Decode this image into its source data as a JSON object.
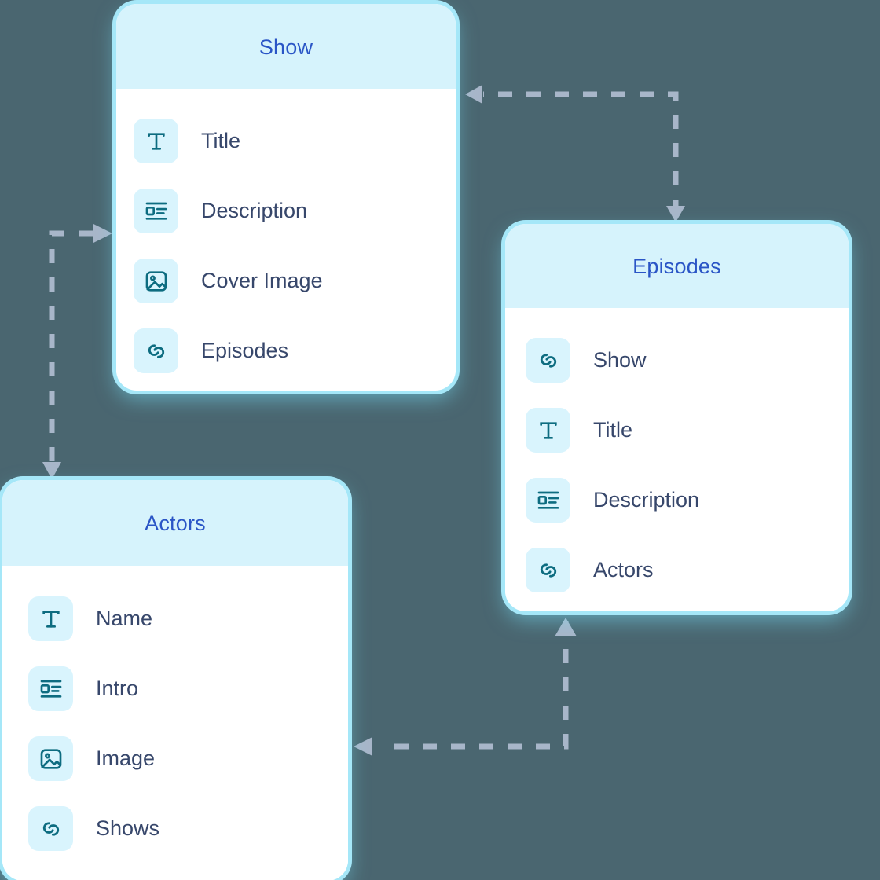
{
  "canvas": {
    "background_color": "#4a6670",
    "grid_color": "#7fdcf3",
    "arrow_color": "#a8b6c9",
    "card_glow_color": "#a5e7f8",
    "header_bg_color": "#d6f3fc",
    "header_text_color": "#2a55c6",
    "icon_tile_color": "#d9f4fd",
    "icon_glyph_color": "#0d6c80",
    "field_text_color": "#37476b"
  },
  "cards": [
    {
      "id": "show",
      "title": "Show",
      "fields": [
        {
          "label": "Title",
          "icon": "text-icon"
        },
        {
          "label": "Description",
          "icon": "rich-text-icon"
        },
        {
          "label": "Cover Image",
          "icon": "image-icon"
        },
        {
          "label": "Episodes",
          "icon": "link-icon"
        }
      ]
    },
    {
      "id": "episodes",
      "title": "Episodes",
      "fields": [
        {
          "label": "Show",
          "icon": "link-icon"
        },
        {
          "label": "Title",
          "icon": "text-icon"
        },
        {
          "label": "Description",
          "icon": "rich-text-icon"
        },
        {
          "label": "Actors",
          "icon": "link-icon"
        }
      ]
    },
    {
      "id": "actors",
      "title": "Actors",
      "fields": [
        {
          "label": "Name",
          "icon": "text-icon"
        },
        {
          "label": "Intro",
          "icon": "rich-text-icon"
        },
        {
          "label": "Image",
          "icon": "image-icon"
        },
        {
          "label": "Shows",
          "icon": "link-icon"
        }
      ]
    }
  ],
  "relations": [
    {
      "id": "episodes-to-show",
      "from": "Episodes",
      "to": "Show",
      "style": "dashed"
    },
    {
      "id": "show-to-actors",
      "from": "Show",
      "to": "Actors",
      "style": "dashed"
    },
    {
      "id": "actors-to-episodes",
      "from": "Actors",
      "to": "Episodes",
      "style": "dashed"
    }
  ]
}
